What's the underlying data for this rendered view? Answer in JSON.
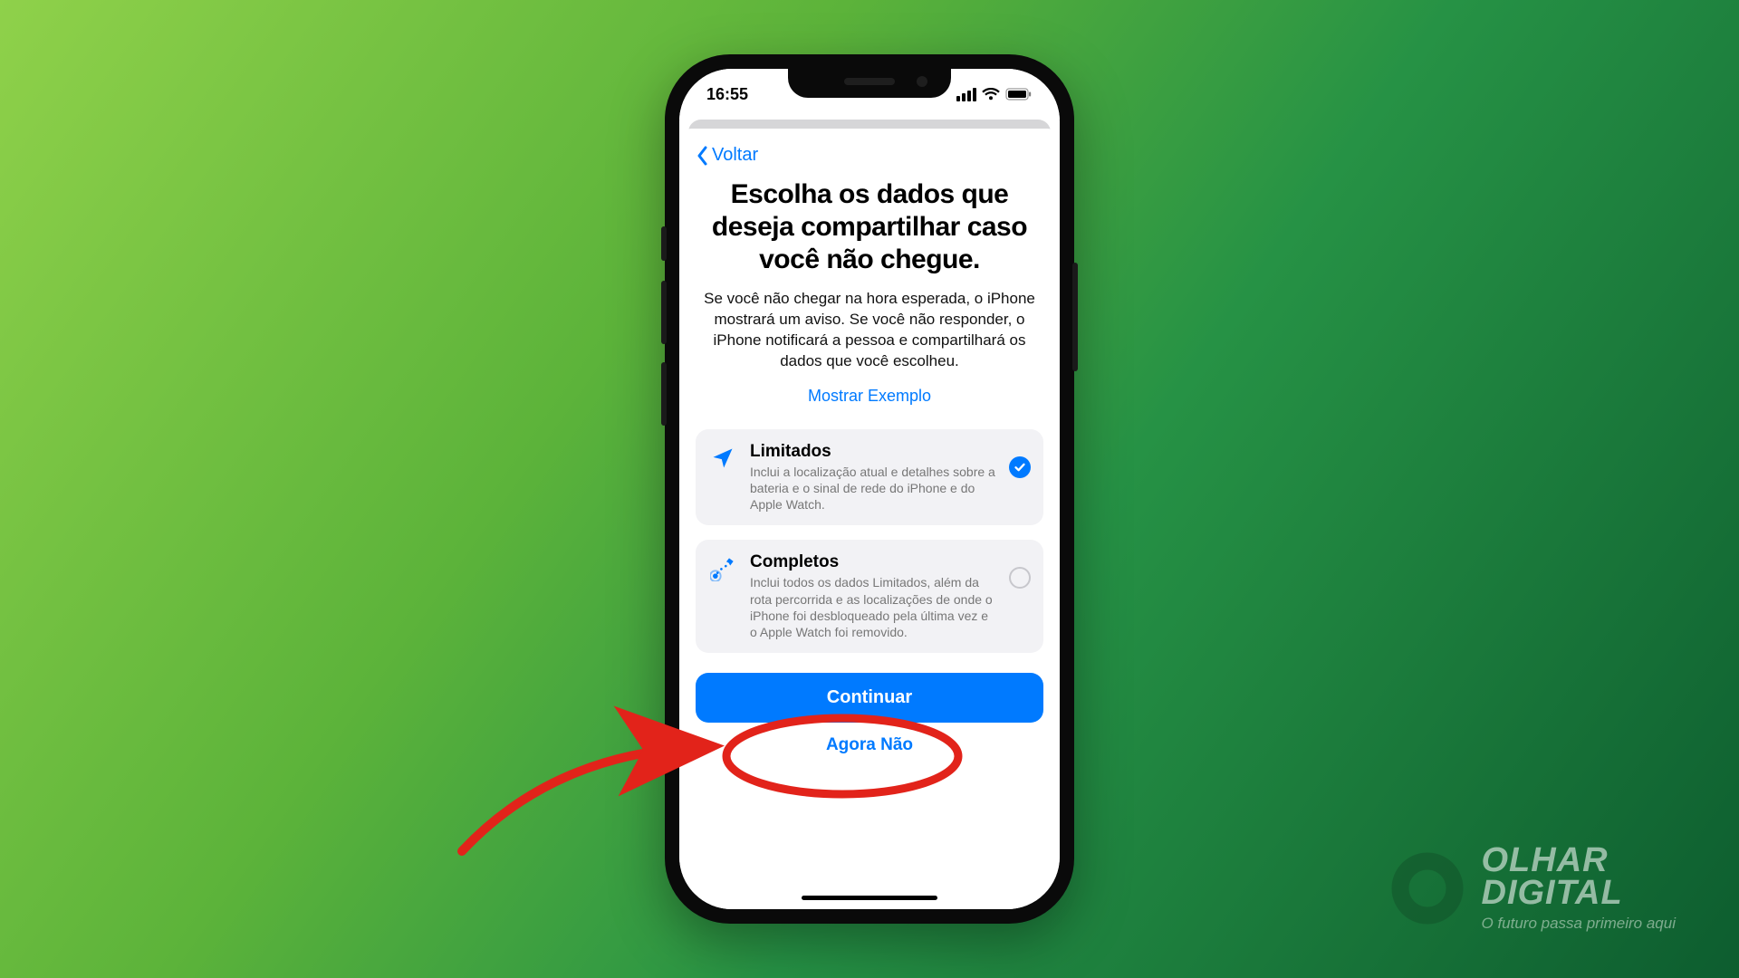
{
  "statusbar": {
    "time": "16:55"
  },
  "nav": {
    "back_label": "Voltar"
  },
  "page": {
    "title": "Escolha os dados que deseja compartilhar caso você não chegue.",
    "description": "Se você não chegar na hora esperada, o iPhone mostrará um aviso. Se você não responder, o iPhone notificará a pessoa e compartilhará os dados que você escolheu.",
    "example_link": "Mostrar Exemplo"
  },
  "options": [
    {
      "title": "Limitados",
      "desc": "Inclui a localização atual e detalhes sobre a bateria e o sinal de rede do iPhone e do Apple Watch.",
      "selected": true,
      "icon": "location"
    },
    {
      "title": "Completos",
      "desc": "Inclui todos os dados Limitados, além da rota percorrida e as localizações de onde o iPhone foi desbloqueado pela última vez e o Apple Watch foi removido.",
      "selected": false,
      "icon": "route"
    }
  ],
  "buttons": {
    "primary": "Continuar",
    "secondary": "Agora Não"
  },
  "watermark": {
    "brand_l1": "OLHAR",
    "brand_l2": "DIGITAL",
    "tagline": "O futuro passa primeiro aqui"
  }
}
